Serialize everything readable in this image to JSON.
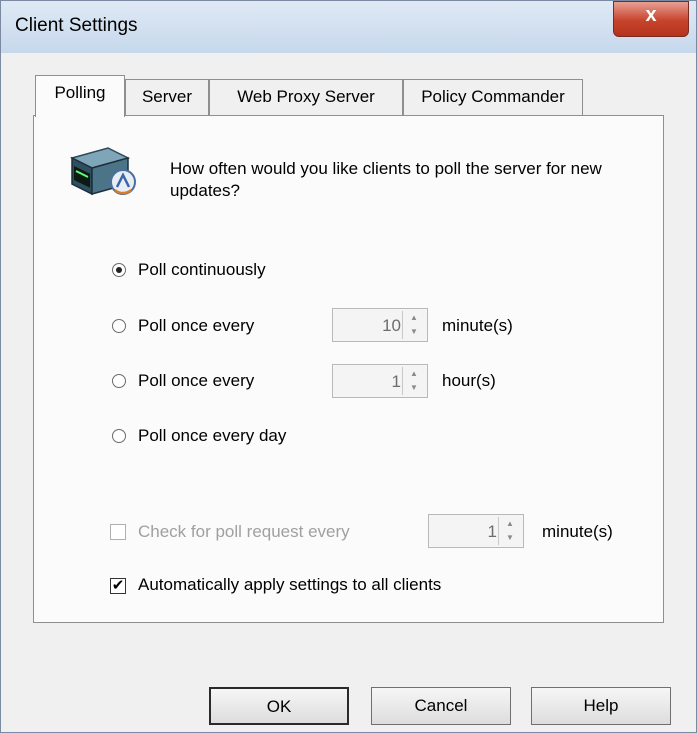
{
  "window": {
    "title": "Client Settings",
    "close_glyph": "x"
  },
  "tabs": [
    {
      "label": "Polling",
      "active": true
    },
    {
      "label": "Server",
      "active": false
    },
    {
      "label": "Web Proxy Server",
      "active": false
    },
    {
      "label": "Policy Commander",
      "active": false
    }
  ],
  "polling": {
    "icon": "server-icon",
    "question": "How often would you like clients to poll the server for new updates?",
    "options": [
      {
        "label": "Poll continuously",
        "selected": true
      },
      {
        "label": "Poll once every",
        "selected": false,
        "value": "10",
        "unit": "minute(s)"
      },
      {
        "label": "Poll once every",
        "selected": false,
        "value": "1",
        "unit": "hour(s)"
      },
      {
        "label": "Poll once every day",
        "selected": false
      }
    ],
    "check_poll": {
      "label": "Check for poll request every",
      "checked": false,
      "enabled": false,
      "value": "1",
      "unit": "minute(s)"
    },
    "auto_apply": {
      "label": "Automatically apply settings to all clients",
      "checked": true
    }
  },
  "buttons": {
    "ok": "OK",
    "cancel": "Cancel",
    "help": "Help"
  }
}
